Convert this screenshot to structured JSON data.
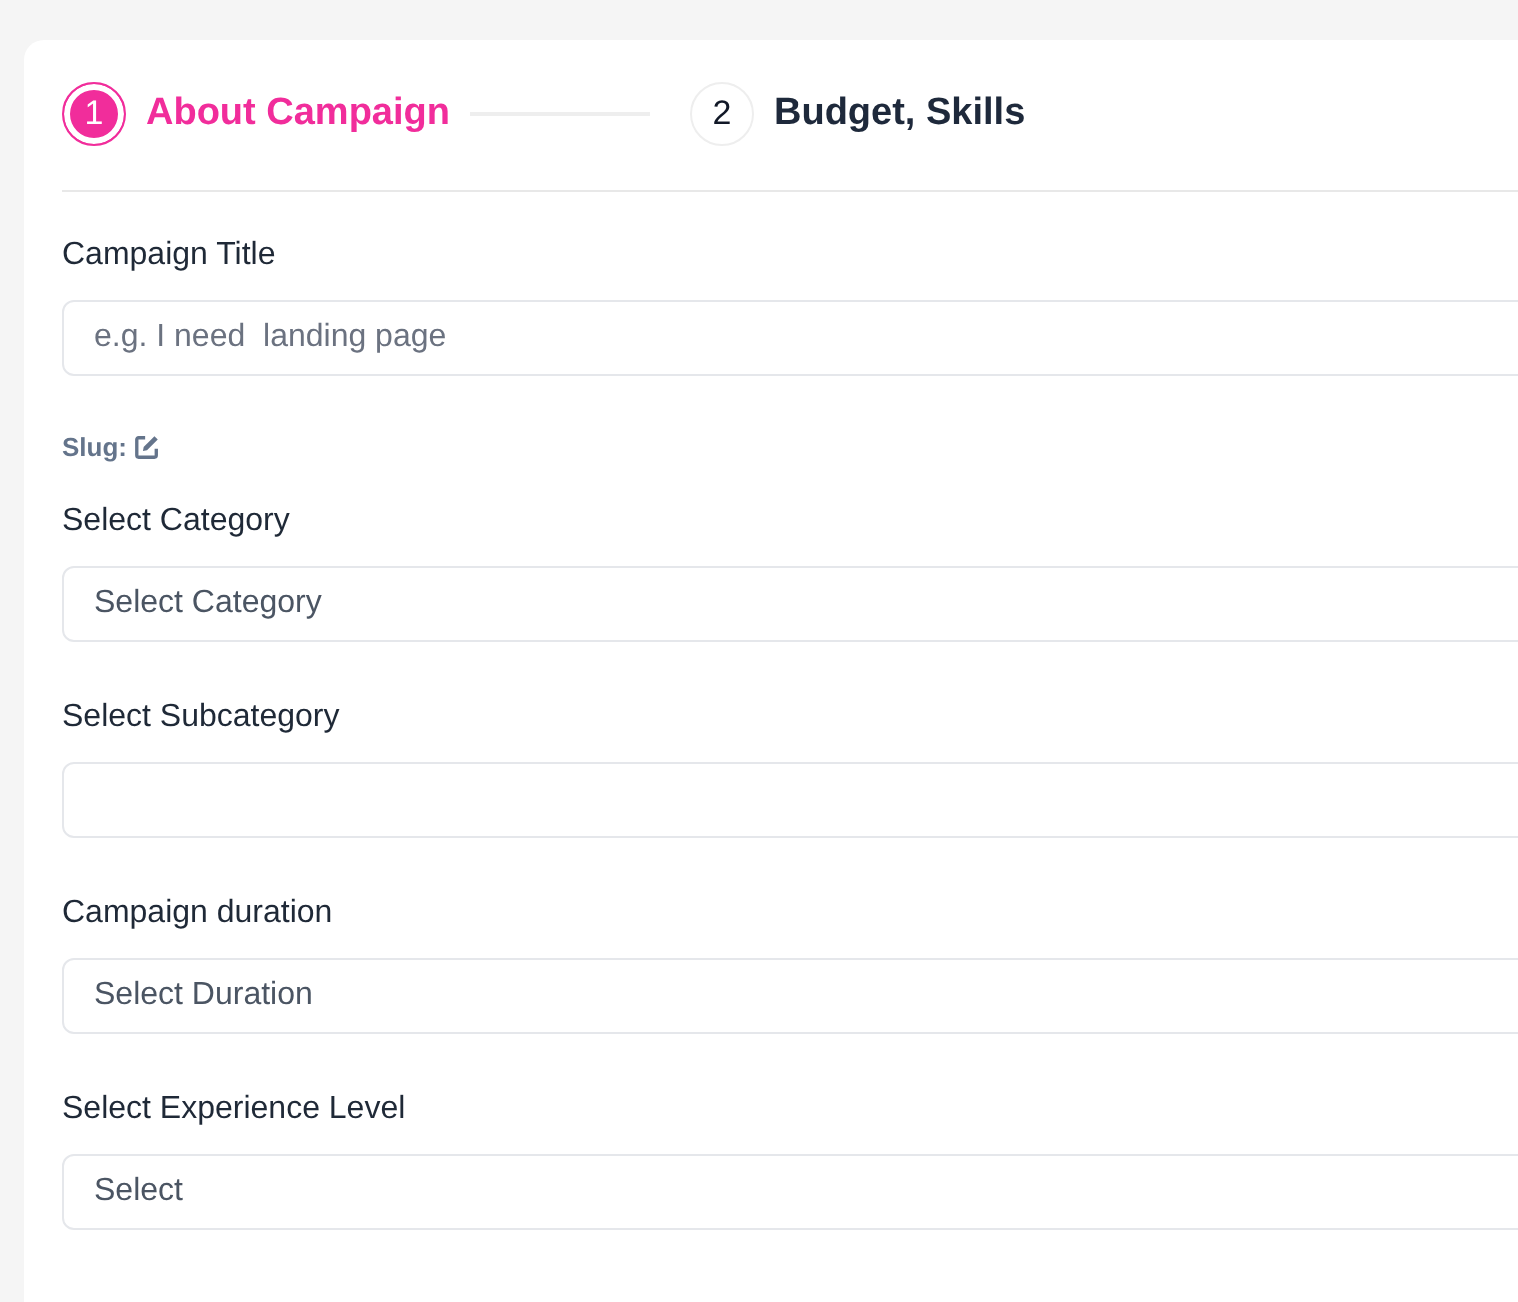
{
  "steps": [
    {
      "number": "1",
      "label": "About Campaign",
      "selected": true
    },
    {
      "number": "2",
      "label": "Budget, Skills",
      "selected": false
    }
  ],
  "fields": [
    {
      "kind": "text",
      "label": "Campaign Title",
      "placeholder": "e.g. I need  landing page"
    },
    {
      "kind": "slug",
      "label": "Slug:"
    },
    {
      "kind": "select",
      "label": "Select Category",
      "value": "Select Category"
    },
    {
      "kind": "select",
      "label": "Select Subcategory"
    },
    {
      "kind": "select",
      "label": "Campaign duration",
      "value": "Select Duration"
    },
    {
      "kind": "select",
      "label": "Select Experience Level",
      "value": "Select"
    }
  ]
}
